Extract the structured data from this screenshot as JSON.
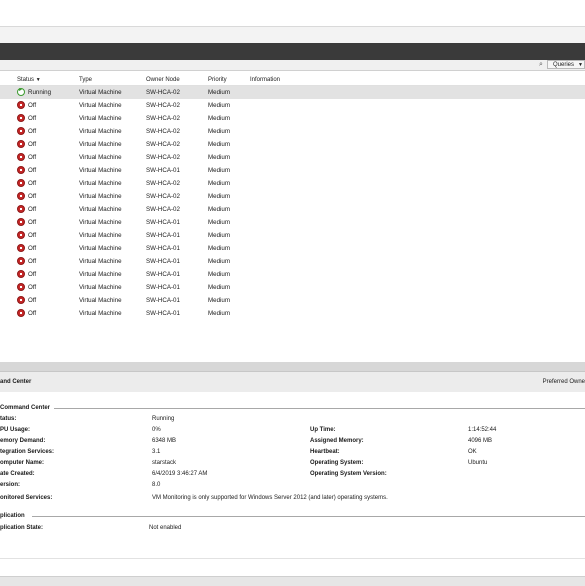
{
  "toolbar": {
    "search_icon": "search-icon",
    "queries_label": "Queries"
  },
  "columns": {
    "status": "Status",
    "type": "Type",
    "owner_node": "Owner Node",
    "priority": "Priority",
    "information": "Information"
  },
  "vms": [
    {
      "status": "Running",
      "type": "Virtual Machine",
      "node": "SW-HCA-02",
      "priority": "Medium"
    },
    {
      "status": "Off",
      "type": "Virtual Machine",
      "node": "SW-HCA-02",
      "priority": "Medium"
    },
    {
      "status": "Off",
      "type": "Virtual Machine",
      "node": "SW-HCA-02",
      "priority": "Medium"
    },
    {
      "status": "Off",
      "type": "Virtual Machine",
      "node": "SW-HCA-02",
      "priority": "Medium"
    },
    {
      "status": "Off",
      "type": "Virtual Machine",
      "node": "SW-HCA-02",
      "priority": "Medium"
    },
    {
      "status": "Off",
      "type": "Virtual Machine",
      "node": "SW-HCA-02",
      "priority": "Medium"
    },
    {
      "status": "Off",
      "type": "Virtual Machine",
      "node": "SW-HCA-01",
      "priority": "Medium"
    },
    {
      "status": "Off",
      "type": "Virtual Machine",
      "node": "SW-HCA-02",
      "priority": "Medium"
    },
    {
      "status": "Off",
      "type": "Virtual Machine",
      "node": "SW-HCA-02",
      "priority": "Medium"
    },
    {
      "status": "Off",
      "type": "Virtual Machine",
      "node": "SW-HCA-02",
      "priority": "Medium"
    },
    {
      "status": "Off",
      "type": "Virtual Machine",
      "node": "SW-HCA-01",
      "priority": "Medium"
    },
    {
      "status": "Off",
      "type": "Virtual Machine",
      "node": "SW-HCA-01",
      "priority": "Medium"
    },
    {
      "status": "Off",
      "type": "Virtual Machine",
      "node": "SW-HCA-01",
      "priority": "Medium"
    },
    {
      "status": "Off",
      "type": "Virtual Machine",
      "node": "SW-HCA-01",
      "priority": "Medium"
    },
    {
      "status": "Off",
      "type": "Virtual Machine",
      "node": "SW-HCA-01",
      "priority": "Medium"
    },
    {
      "status": "Off",
      "type": "Virtual Machine",
      "node": "SW-HCA-01",
      "priority": "Medium"
    },
    {
      "status": "Off",
      "type": "Virtual Machine",
      "node": "SW-HCA-01",
      "priority": "Medium"
    },
    {
      "status": "Off",
      "type": "Virtual Machine",
      "node": "SW-HCA-01",
      "priority": "Medium"
    }
  ],
  "details": {
    "title": "and Center",
    "preferred_owners": "Preferred Owne",
    "group_title": "Command Center",
    "left": [
      {
        "label": "tatus:",
        "value": "Running"
      },
      {
        "label": "PU Usage:",
        "value": "0%"
      },
      {
        "label": "emory Demand:",
        "value": "6348 MB"
      },
      {
        "label": "tegration Services:",
        "value": "3.1"
      },
      {
        "label": "omputer Name:",
        "value": "starstack"
      },
      {
        "label": "ate Created:",
        "value": "6/4/2019 3:46:27 AM"
      },
      {
        "label": "ersion:",
        "value": "8.0"
      }
    ],
    "right": [
      {
        "label": "Up Time:",
        "value": "1:14:52:44"
      },
      {
        "label": "Assigned Memory:",
        "value": "4096 MB"
      },
      {
        "label": "Heartbeat:",
        "value": "OK"
      },
      {
        "label": "Operating System:",
        "value": "Ubuntu"
      },
      {
        "label": "Operating System Version:",
        "value": ""
      }
    ],
    "monitored_label": "onitored Services:",
    "monitored_value": "VM Monitoring is only supported for Windows Server 2012 (and later) operating systems.",
    "replication_title": "plication",
    "replication_label": "plication State:",
    "replication_value": "Not enabled"
  }
}
